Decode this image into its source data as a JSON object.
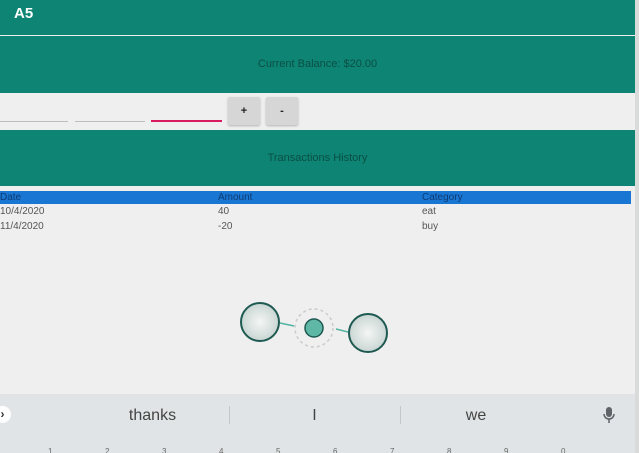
{
  "app": {
    "title": "A5"
  },
  "balance": {
    "text": "Current Balance: $20.00"
  },
  "controls": {
    "plus_label": "+",
    "minus_label": "-"
  },
  "history": {
    "title": "Transactions History"
  },
  "table": {
    "headers": [
      "Date",
      "Amount",
      "Category"
    ],
    "rows": [
      [
        "10/4/2020",
        "40",
        "eat"
      ],
      [
        "11/4/2020",
        "-20",
        "buy"
      ]
    ]
  },
  "keyboard": {
    "suggestions": [
      "thanks",
      "I",
      "we"
    ],
    "expand_glyph": "›",
    "number_row": [
      "1",
      "2",
      "3",
      "4",
      "5",
      "6",
      "7",
      "8",
      "9",
      "0"
    ]
  },
  "colors": {
    "primary": "#0e8574",
    "accent": "#d81b60",
    "table_header": "#1976d2"
  }
}
